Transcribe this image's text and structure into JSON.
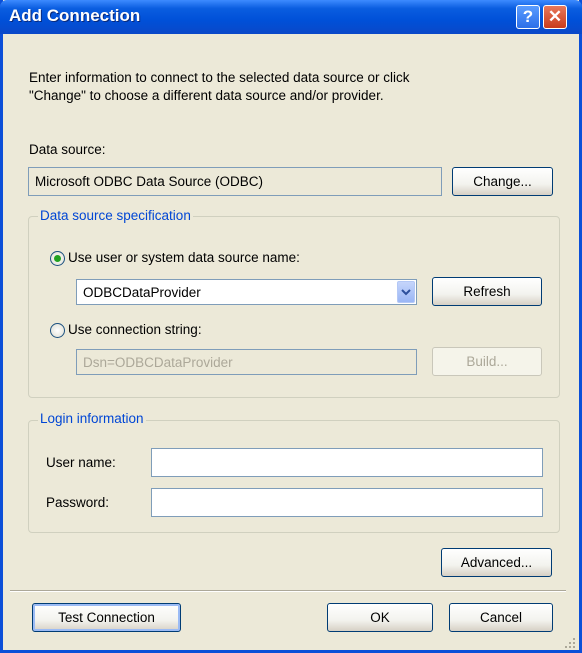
{
  "window": {
    "title": "Add Connection",
    "help_glyph": "?",
    "close_glyph": "✕"
  },
  "intro": {
    "line1": "Enter information to connect to the selected data source or click",
    "line2": "\"Change\" to choose a different data source and/or provider."
  },
  "data_source": {
    "label": "Data source:",
    "value": "Microsoft ODBC Data Source (ODBC)",
    "change_label": "Change..."
  },
  "spec": {
    "legend": "Data source specification",
    "use_dsn_label": "Use user or system data source name:",
    "use_dsn_selected": true,
    "dsn_value": "ODBCDataProvider",
    "refresh_label": "Refresh",
    "use_conn_label": "Use connection string:",
    "conn_value": "Dsn=ODBCDataProvider",
    "build_label": "Build..."
  },
  "login": {
    "legend": "Login information",
    "user_label": "User name:",
    "user_value": "",
    "password_label": "Password:",
    "password_value": ""
  },
  "buttons": {
    "advanced": "Advanced...",
    "test": "Test Connection",
    "ok": "OK",
    "cancel": "Cancel"
  },
  "colors": {
    "titlebar": "#0054e3",
    "dialog_bg": "#ece9d8",
    "legend_text": "#0046d5",
    "radio_dot": "#21a121"
  },
  "icons": [
    "help-icon",
    "close-icon",
    "chevron-down-icon"
  ]
}
